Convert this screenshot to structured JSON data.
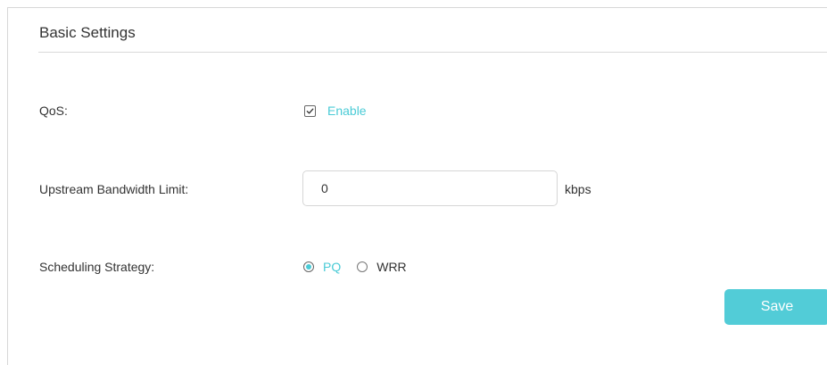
{
  "section": {
    "title": "Basic Settings"
  },
  "qos": {
    "label": "QoS:",
    "enable_label": "Enable",
    "enabled": true
  },
  "upstream": {
    "label": "Upstream Bandwidth Limit:",
    "value": "0",
    "unit": "kbps"
  },
  "scheduling": {
    "label": "Scheduling Strategy:",
    "options": [
      {
        "label": "PQ",
        "selected": true
      },
      {
        "label": "WRR",
        "selected": false
      }
    ]
  },
  "actions": {
    "save_label": "Save"
  },
  "colors": {
    "accent": "#4acbd6",
    "save_button": "#52ccd7",
    "text": "#333333",
    "border": "#d6d6d6"
  },
  "icons": {
    "checkbox": "check-icon",
    "radio_selected": "radio-dot-icon"
  }
}
